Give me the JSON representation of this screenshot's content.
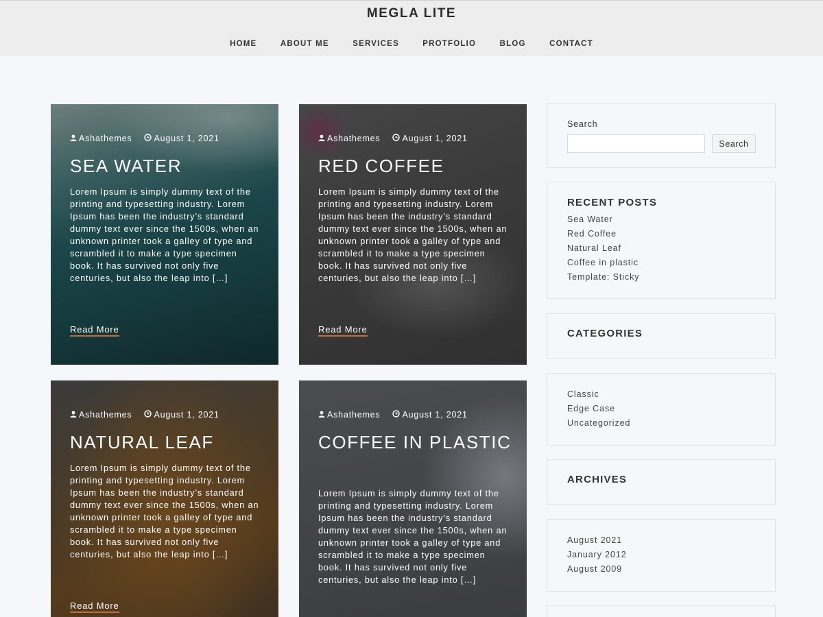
{
  "site": {
    "title": "MEGLA LITE"
  },
  "nav": [
    "HOME",
    "ABOUT ME",
    "SERVICES",
    "PROTFOLIO",
    "BLOG",
    "CONTACT"
  ],
  "posts": [
    {
      "author": "Ashathemes",
      "date": "August 1, 2021",
      "title": "SEA WATER",
      "excerpt": "Lorem Ipsum is simply dummy text of the printing and typesetting industry. Lorem Ipsum has been the industry’s standard dummy text ever since the 1500s, when an unknown printer took a galley of type and scrambled it to make a type specimen book. It has survived not only five centuries, but also the leap into […]",
      "read_more": "Read More"
    },
    {
      "author": "Ashathemes",
      "date": "August 1, 2021",
      "title": "RED COFFEE",
      "excerpt": "Lorem Ipsum is simply dummy text of the printing and typesetting industry. Lorem Ipsum has been the industry’s standard dummy text ever since the 1500s, when an unknown printer took a galley of type and scrambled it to make a type specimen book. It has survived not only five centuries, but also the leap into […]",
      "read_more": "Read More"
    },
    {
      "author": "Ashathemes",
      "date": "August 1, 2021",
      "title": "NATURAL LEAF",
      "excerpt": "Lorem Ipsum is simply dummy text of the printing and typesetting industry. Lorem Ipsum has been the industry’s standard dummy text ever since the 1500s, when an unknown printer took a galley of type and scrambled it to make a type specimen book. It has survived not only five centuries, but also the leap into […]",
      "read_more": "Read More"
    },
    {
      "author": "Ashathemes",
      "date": "August 1, 2021",
      "title": "COFFEE IN PLASTIC",
      "excerpt": "Lorem Ipsum is simply dummy text of the printing and typesetting industry. Lorem Ipsum has been the industry’s standard dummy text ever since the 1500s, when an unknown printer took a galley of type and scrambled it to make a type specimen book. It has survived not only five centuries, but also the leap into […]",
      "read_more": "Read More"
    }
  ],
  "sidebar": {
    "search": {
      "label": "Search",
      "button": "Search",
      "value": "",
      "placeholder": ""
    },
    "recent_posts": {
      "title": "RECENT POSTS",
      "items": [
        "Sea Water",
        "Red Coffee",
        "Natural Leaf",
        "Coffee in plastic",
        "Template: Sticky"
      ]
    },
    "categories_title": "CATEGORIES",
    "categories": [
      "Classic",
      "Edge Case",
      "Uncategorized"
    ],
    "archives_title": "ARCHIVES",
    "archives": [
      "August 2021",
      "January 2012",
      "August 2009"
    ]
  },
  "icons": {
    "author": "user-icon",
    "date": "clock-icon"
  }
}
